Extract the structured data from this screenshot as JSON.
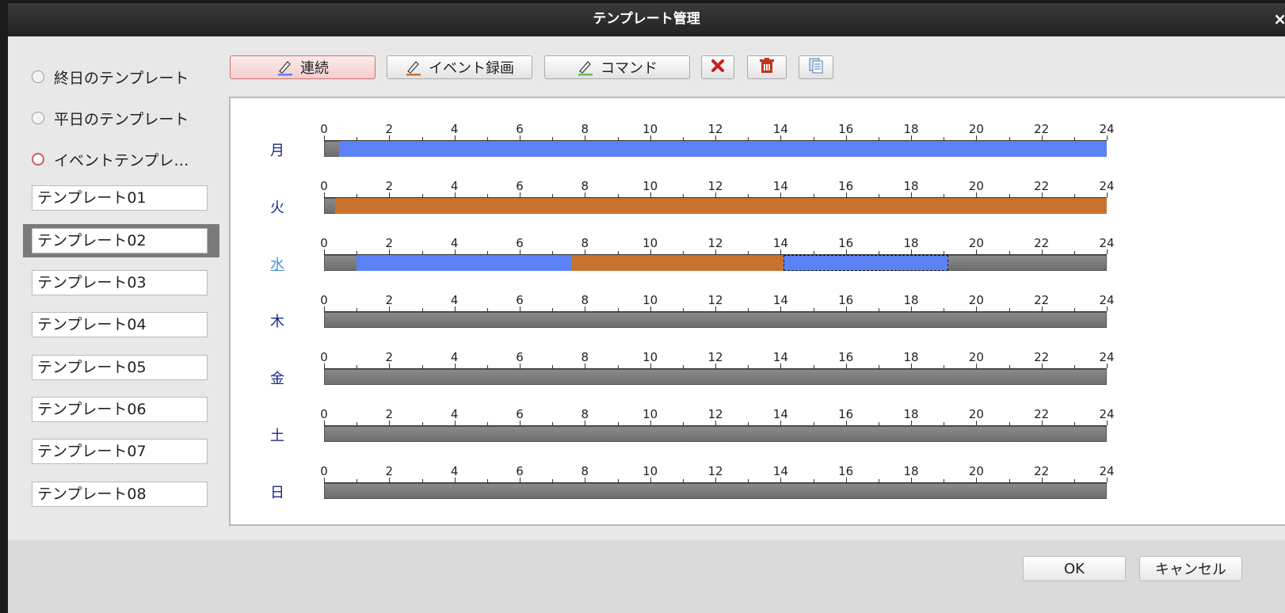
{
  "window": {
    "title": "テンプレート管理",
    "close_label": "×"
  },
  "left_panel": {
    "radios": [
      {
        "label": "終日のテンプレート",
        "selected": false
      },
      {
        "label": "平日のテンプレート",
        "selected": false
      },
      {
        "label": "イベントテンプレ…",
        "selected": true
      }
    ],
    "templates": [
      "テンプレート01",
      "テンプレート02",
      "テンプレート03",
      "テンプレート04",
      "テンプレート05",
      "テンプレート06",
      "テンプレート07",
      "テンプレート08"
    ],
    "selected_template_index": 1
  },
  "toolbar": {
    "continuous_label": "連続",
    "event_record_label": "イベント録画",
    "command_label": "コマンド",
    "icons": [
      "clear-icon",
      "delete-icon",
      "copy-icon"
    ]
  },
  "schedule": {
    "hour_ticks": [
      "0",
      "2",
      "4",
      "6",
      "8",
      "10",
      "12",
      "14",
      "16",
      "18",
      "20",
      "22",
      "24"
    ],
    "colors": {
      "continuous": "#5b82f5",
      "event": "#c8722e",
      "empty": "#7a7a7a"
    },
    "days": [
      {
        "label": "月",
        "segments": [
          {
            "type": "continuous",
            "start": 0.45,
            "end": 24
          }
        ]
      },
      {
        "label": "火",
        "segments": [
          {
            "type": "event",
            "start": 0.35,
            "end": 24
          }
        ]
      },
      {
        "label": "水",
        "link": true,
        "segments": [
          {
            "type": "continuous",
            "start": 1.0,
            "end": 7.6
          },
          {
            "type": "event",
            "start": 7.6,
            "end": 14.1
          },
          {
            "type": "continuous",
            "start": 14.1,
            "end": 19.15,
            "selected": true
          }
        ]
      },
      {
        "label": "木",
        "segments": []
      },
      {
        "label": "金",
        "segments": []
      },
      {
        "label": "土",
        "segments": []
      },
      {
        "label": "日",
        "segments": []
      }
    ]
  },
  "footer": {
    "ok_label": "OK",
    "cancel_label": "キャンセル"
  }
}
